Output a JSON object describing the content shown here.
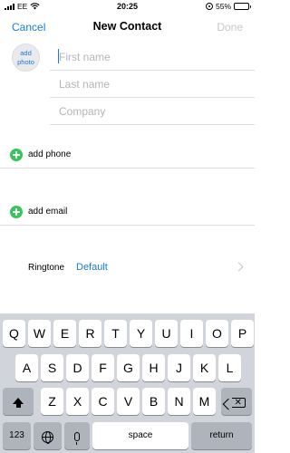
{
  "status_bar": {
    "carrier": "EE",
    "time": "20:25",
    "battery": "55%",
    "battery_level": 0.55
  },
  "nav": {
    "cancel_label": "Cancel",
    "title": "New Contact",
    "done_label": "Done"
  },
  "photo": {
    "line1": "add",
    "line2": "photo"
  },
  "fields": {
    "first_name": {
      "value": "",
      "placeholder": "First name"
    },
    "last_name": {
      "value": "",
      "placeholder": "Last name"
    },
    "company": {
      "value": "",
      "placeholder": "Company"
    }
  },
  "actions": {
    "add_phone": "add phone",
    "add_email": "add email"
  },
  "ringtone": {
    "label": "Ringtone",
    "value": "Default"
  },
  "keyboard": {
    "row1": [
      "Q",
      "W",
      "E",
      "R",
      "T",
      "Y",
      "U",
      "I",
      "O",
      "P"
    ],
    "row2": [
      "A",
      "S",
      "D",
      "F",
      "G",
      "H",
      "J",
      "K",
      "L"
    ],
    "row3": [
      "Z",
      "X",
      "C",
      "V",
      "B",
      "N",
      "M"
    ],
    "numbers_key": "123",
    "space_key": "space",
    "return_key": "return"
  }
}
